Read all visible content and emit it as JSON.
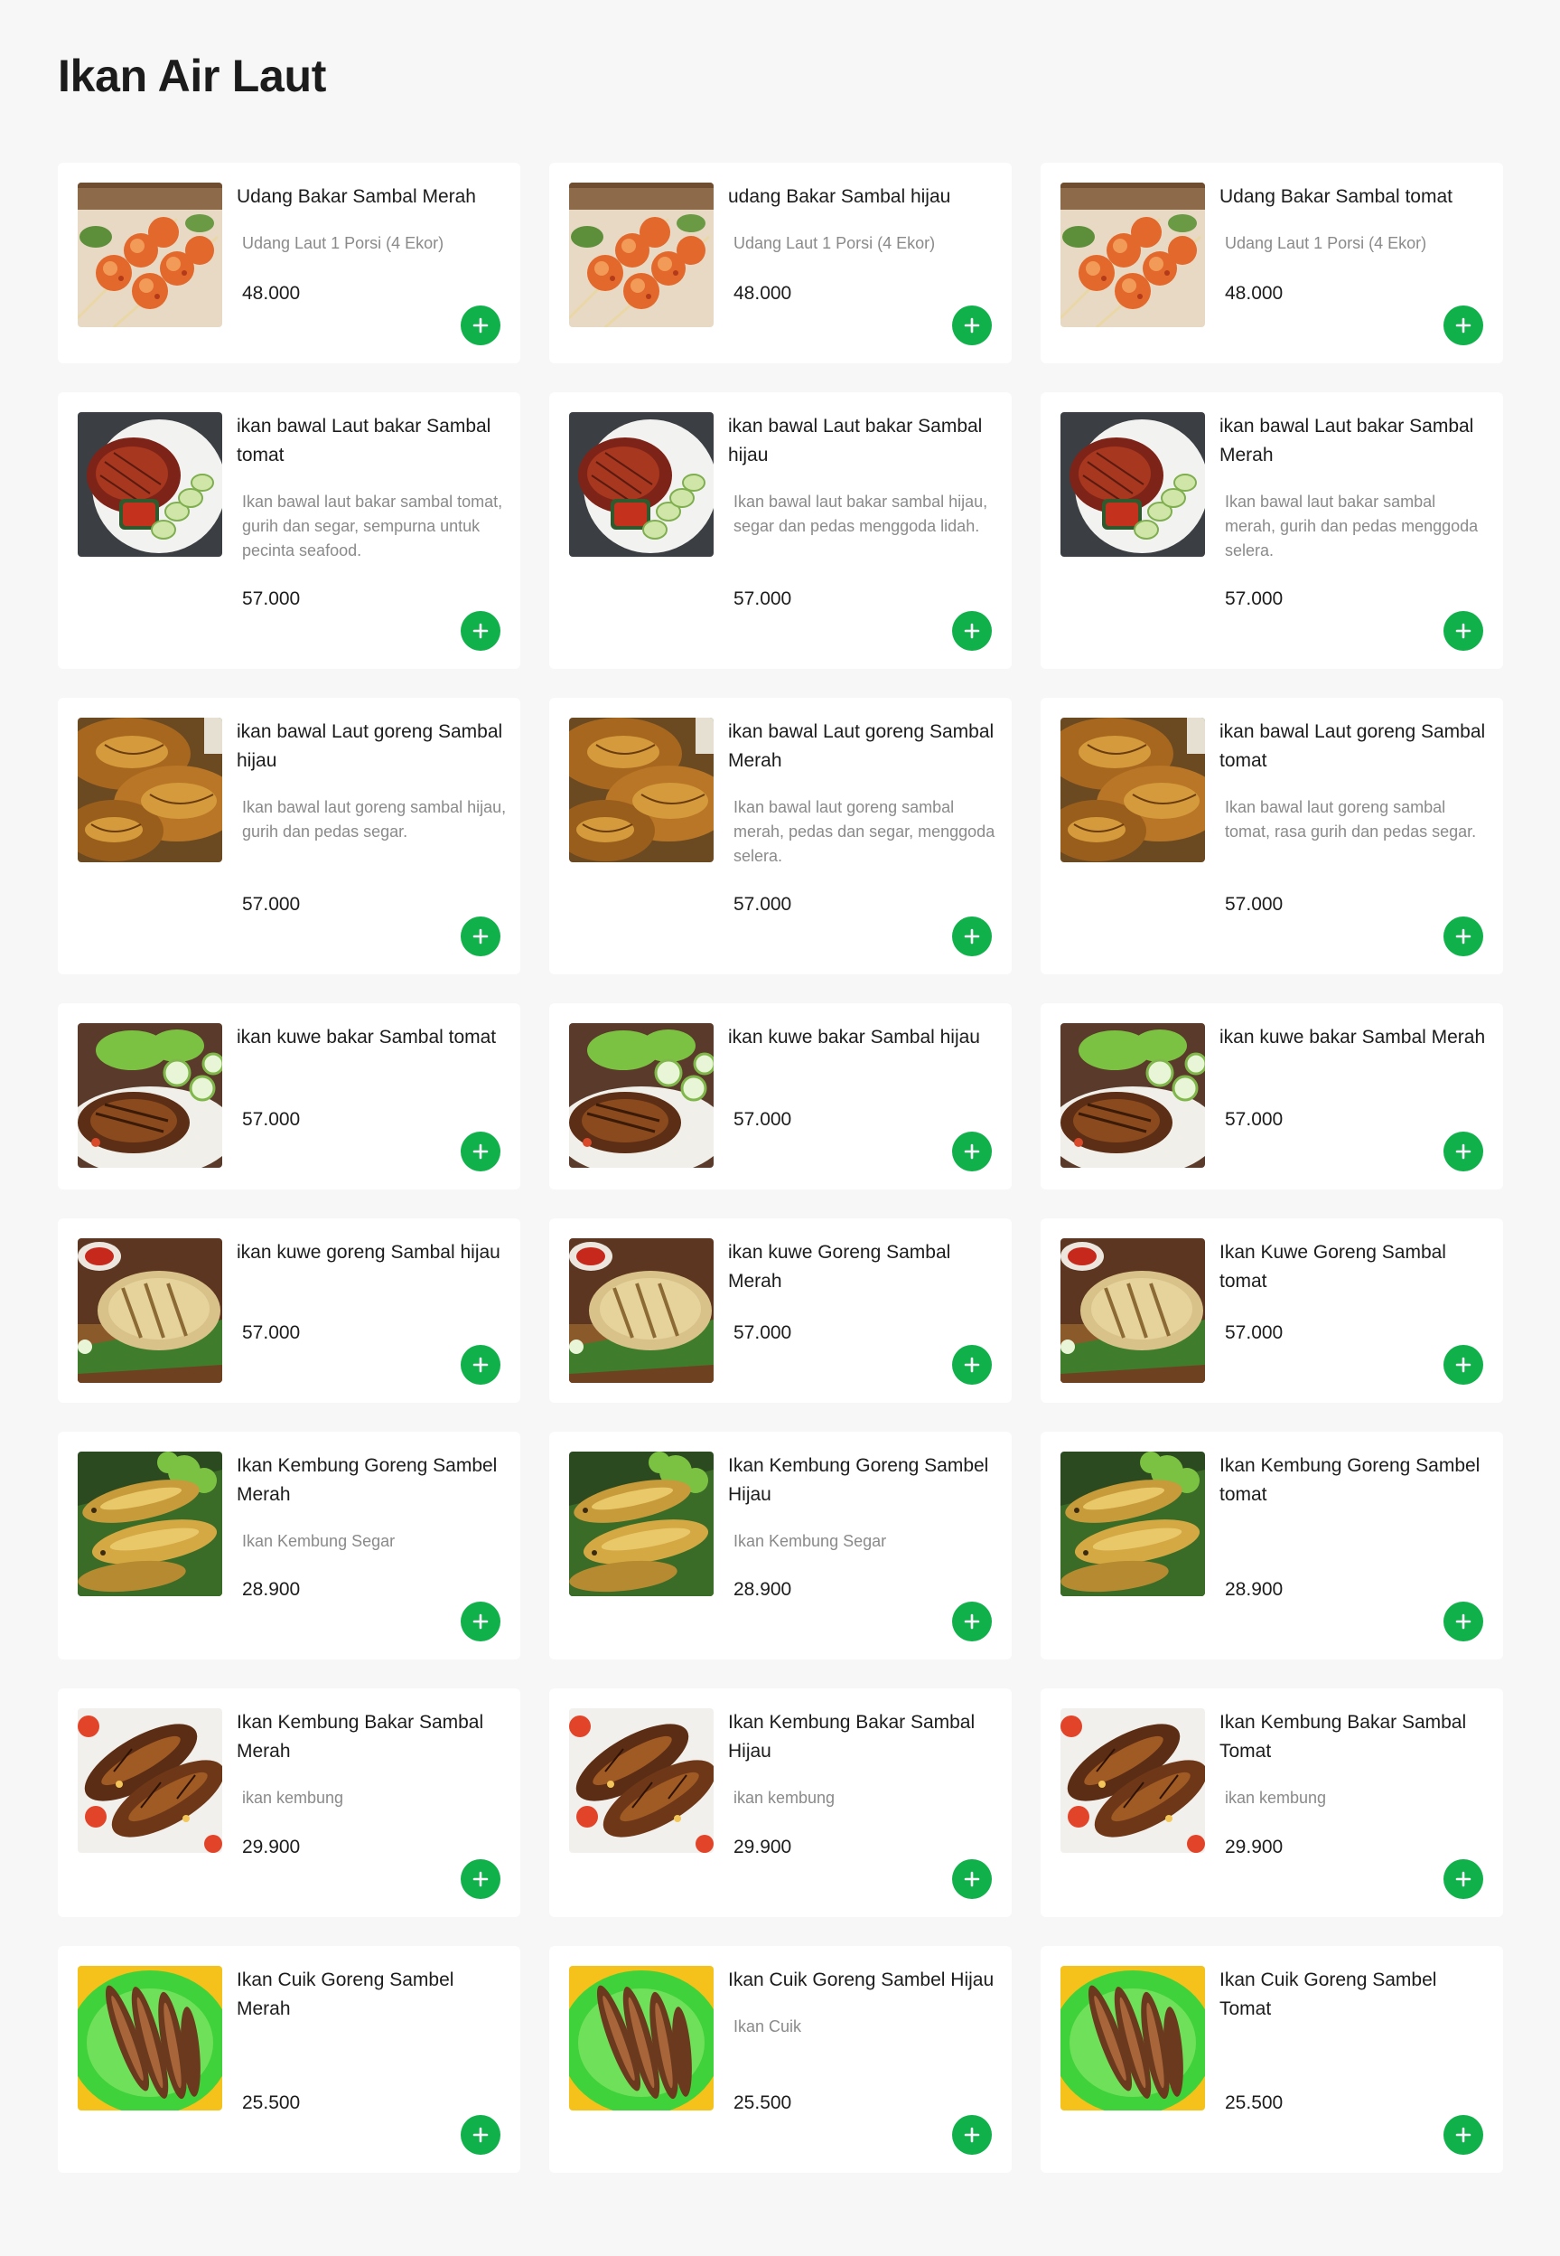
{
  "page": {
    "title": "Ikan Air Laut"
  },
  "colors": {
    "background": "#f7f7f7",
    "card": "#ffffff",
    "add_button": "#10b04a",
    "description_text": "#8a8a8a"
  },
  "products": [
    {
      "name": "Udang Bakar Sambal Merah",
      "description": "Udang Laut 1 Porsi (4 Ekor)",
      "price": "48.000",
      "image": "shrimp-skewers-photo"
    },
    {
      "name": "udang Bakar Sambal hijau",
      "description": "Udang Laut 1 Porsi (4 Ekor)",
      "price": "48.000",
      "image": "shrimp-skewers-photo"
    },
    {
      "name": "Udang Bakar Sambal tomat",
      "description": "Udang Laut 1 Porsi (4 Ekor)",
      "price": "48.000",
      "image": "shrimp-skewers-photo"
    },
    {
      "name": "ikan bawal Laut bakar Sambal tomat",
      "description": "Ikan bawal laut bakar sambal tomat, gurih dan segar, sempurna untuk pecinta seafood.",
      "price": "57.000",
      "image": "grilled-pomfret-plate-photo"
    },
    {
      "name": "ikan bawal Laut bakar Sambal hijau",
      "description": "Ikan bawal laut bakar sambal hijau, segar dan pedas menggoda lidah.",
      "price": "57.000",
      "image": "grilled-pomfret-plate-photo"
    },
    {
      "name": "ikan bawal Laut bakar Sambal Merah",
      "description": "Ikan bawal laut bakar sambal merah, gurih dan pedas menggoda selera.",
      "price": "57.000",
      "image": "grilled-pomfret-plate-photo"
    },
    {
      "name": "ikan bawal Laut goreng Sambal hijau",
      "description": "Ikan bawal laut goreng sambal hijau, gurih dan pedas segar.",
      "price": "57.000",
      "image": "fried-pomfret-photo"
    },
    {
      "name": "ikan bawal Laut goreng Sambal Merah",
      "description": "Ikan bawal laut goreng sambal merah, pedas dan segar, menggoda selera.",
      "price": "57.000",
      "image": "fried-pomfret-photo"
    },
    {
      "name": "ikan bawal Laut goreng Sambal tomat",
      "description": "Ikan bawal laut goreng sambal tomat, rasa gurih dan pedas segar.",
      "price": "57.000",
      "image": "fried-pomfret-photo"
    },
    {
      "name": "ikan kuwe bakar Sambal tomat",
      "description": "",
      "price": "57.000",
      "image": "grilled-trevally-salad-photo"
    },
    {
      "name": "ikan kuwe bakar Sambal hijau",
      "description": "",
      "price": "57.000",
      "image": "grilled-trevally-salad-photo"
    },
    {
      "name": "ikan kuwe bakar Sambal Merah",
      "description": "",
      "price": "57.000",
      "image": "grilled-trevally-salad-photo"
    },
    {
      "name": "ikan kuwe goreng Sambal hijau",
      "description": "",
      "price": "57.000",
      "image": "fried-trevally-board-photo"
    },
    {
      "name": "ikan kuwe Goreng Sambal Merah",
      "description": "",
      "price": "57.000",
      "image": "fried-trevally-board-photo"
    },
    {
      "name": "Ikan Kuwe Goreng Sambal tomat",
      "description": "",
      "price": "57.000",
      "image": "fried-trevally-board-photo"
    },
    {
      "name": "Ikan Kembung Goreng Sambel Merah",
      "description": "Ikan Kembung Segar",
      "price": "28.900",
      "image": "fried-mackerel-photo"
    },
    {
      "name": "Ikan Kembung Goreng Sambel Hijau",
      "description": "Ikan Kembung Segar",
      "price": "28.900",
      "image": "fried-mackerel-photo"
    },
    {
      "name": "Ikan Kembung Goreng Sambel tomat",
      "description": "",
      "price": "28.900",
      "image": "fried-mackerel-photo"
    },
    {
      "name": "Ikan Kembung Bakar Sambal Merah",
      "description": "ikan kembung",
      "price": "29.900",
      "image": "grilled-mackerel-photo"
    },
    {
      "name": "Ikan Kembung Bakar Sambal Hijau",
      "description": "ikan kembung",
      "price": "29.900",
      "image": "grilled-mackerel-photo"
    },
    {
      "name": "Ikan Kembung Bakar Sambal Tomat",
      "description": "ikan kembung",
      "price": "29.900",
      "image": "grilled-mackerel-photo"
    },
    {
      "name": "Ikan Cuik Goreng Sambel Merah",
      "description": "",
      "price": "25.500",
      "image": "fried-cuik-fish-photo"
    },
    {
      "name": "Ikan Cuik Goreng Sambel Hijau",
      "description": "Ikan Cuik",
      "price": "25.500",
      "image": "fried-cuik-fish-photo"
    },
    {
      "name": "Ikan Cuik Goreng Sambel Tomat",
      "description": "",
      "price": "25.500",
      "image": "fried-cuik-fish-photo"
    }
  ]
}
